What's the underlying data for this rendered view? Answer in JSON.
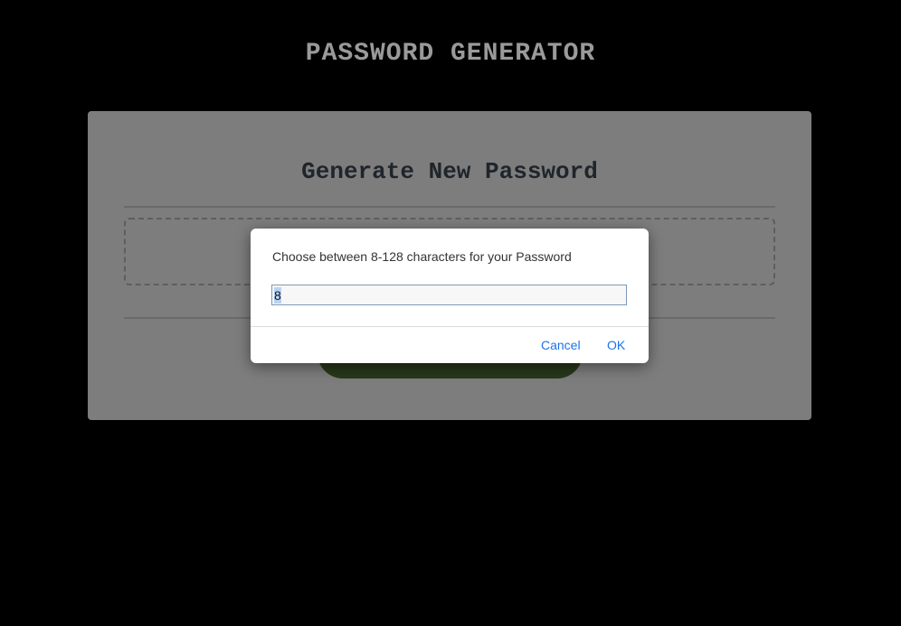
{
  "header": {
    "title": "PASSWORD GENERATOR"
  },
  "card": {
    "title": "Generate New Password",
    "password_placeholder": "",
    "generate_button_label": ""
  },
  "dialog": {
    "message": "Choose between 8-128 characters for your Password",
    "input_value": "8",
    "cancel_label": "Cancel",
    "ok_label": "OK"
  },
  "colors": {
    "background": "#000000",
    "card": "#7d7d7d",
    "button": "#27381a",
    "link": "#1a73e8"
  }
}
